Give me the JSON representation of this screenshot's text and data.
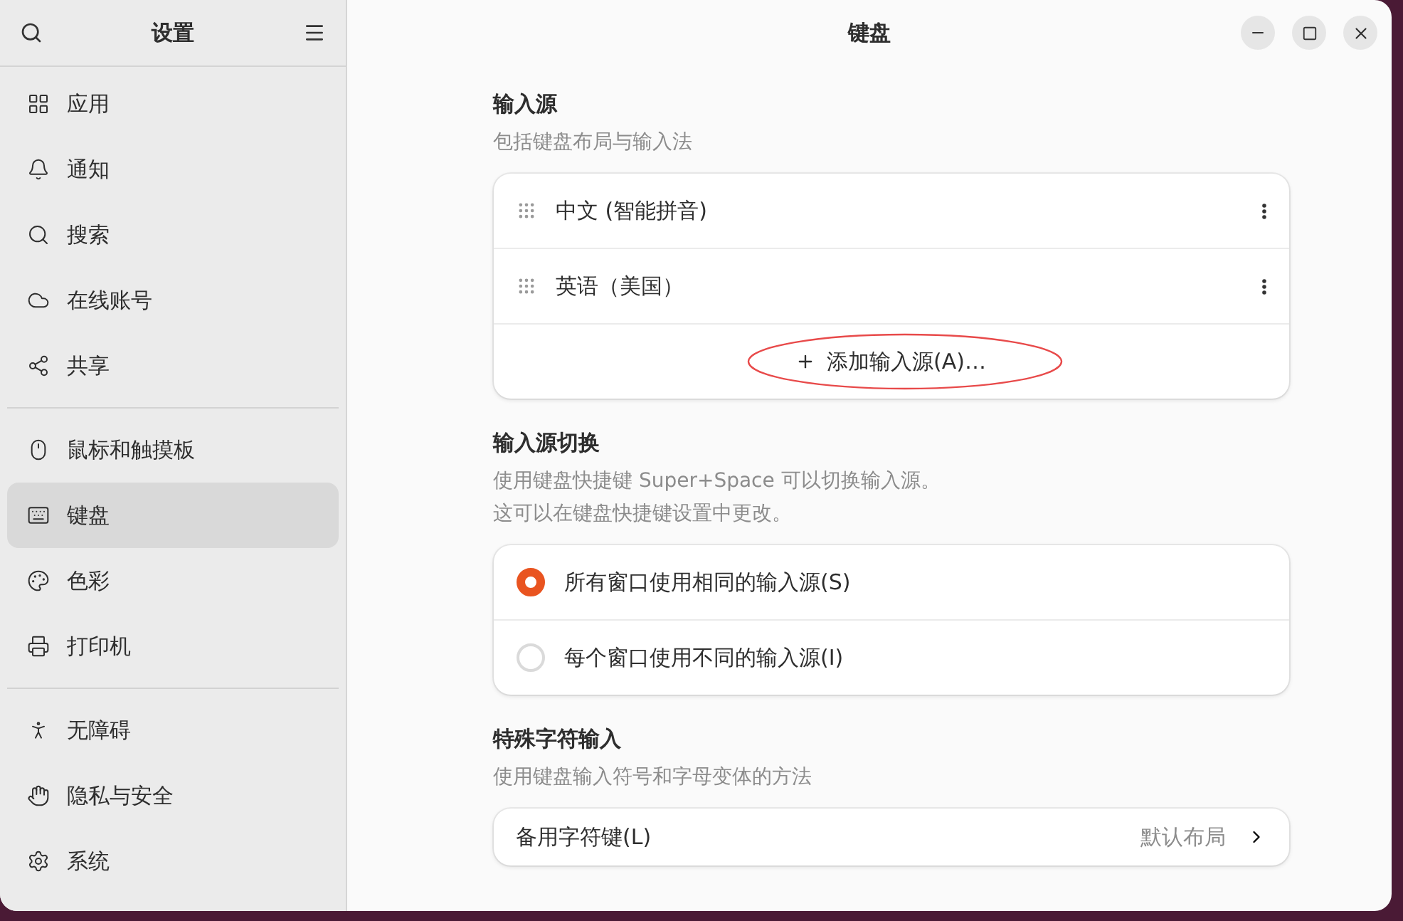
{
  "sidebar": {
    "title": "设置",
    "groups": [
      [
        {
          "label": "应用",
          "selected": false
        },
        {
          "label": "通知",
          "selected": false
        },
        {
          "label": "搜索",
          "selected": false
        },
        {
          "label": "在线账号",
          "selected": false
        },
        {
          "label": "共享",
          "selected": false
        }
      ],
      [
        {
          "label": "鼠标和触摸板",
          "selected": false
        },
        {
          "label": "键盘",
          "selected": true
        },
        {
          "label": "色彩",
          "selected": false
        },
        {
          "label": "打印机",
          "selected": false
        }
      ],
      [
        {
          "label": "无障碍",
          "selected": false
        },
        {
          "label": "隐私与安全",
          "selected": false
        },
        {
          "label": "系统",
          "selected": false
        }
      ]
    ]
  },
  "window": {
    "title": "键盘"
  },
  "input_sources": {
    "title": "输入源",
    "subtitle": "包括键盘布局与输入法",
    "items": [
      "中文 (智能拼音)",
      "英语（美国）"
    ],
    "add_button": "添加输入源(A)…"
  },
  "switching": {
    "title": "输入源切换",
    "description": [
      "使用键盘快捷键 Super+Space 可以切换输入源。",
      "这可以在键盘快捷键设置中更改。"
    ],
    "options": [
      {
        "label": "所有窗口使用相同的输入源(S)",
        "selected": true
      },
      {
        "label": "每个窗口使用不同的输入源(I)",
        "selected": false
      }
    ]
  },
  "special_chars": {
    "title": "特殊字符输入",
    "subtitle": "使用键盘输入符号和字母变体的方法",
    "rows": [
      {
        "label": "备用字符键(L)",
        "value": "默认布局"
      }
    ]
  }
}
